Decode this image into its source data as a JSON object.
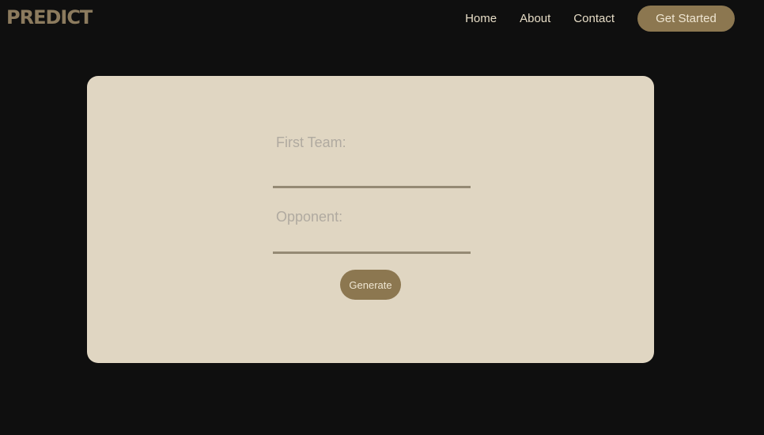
{
  "brand": {
    "logo": "PREDICT"
  },
  "nav": {
    "links": [
      "Home",
      "About",
      "Contact"
    ],
    "cta_label": "Get Started"
  },
  "form": {
    "first_team_label": "First Team:",
    "first_team_value": "",
    "opponent_label": "Opponent:",
    "opponent_value": "",
    "submit_label": "Generate"
  },
  "colors": {
    "background": "#0f0f0f",
    "card": "#e0d6c2",
    "accent": "#8c7750",
    "logo": "#8c7b5e"
  }
}
